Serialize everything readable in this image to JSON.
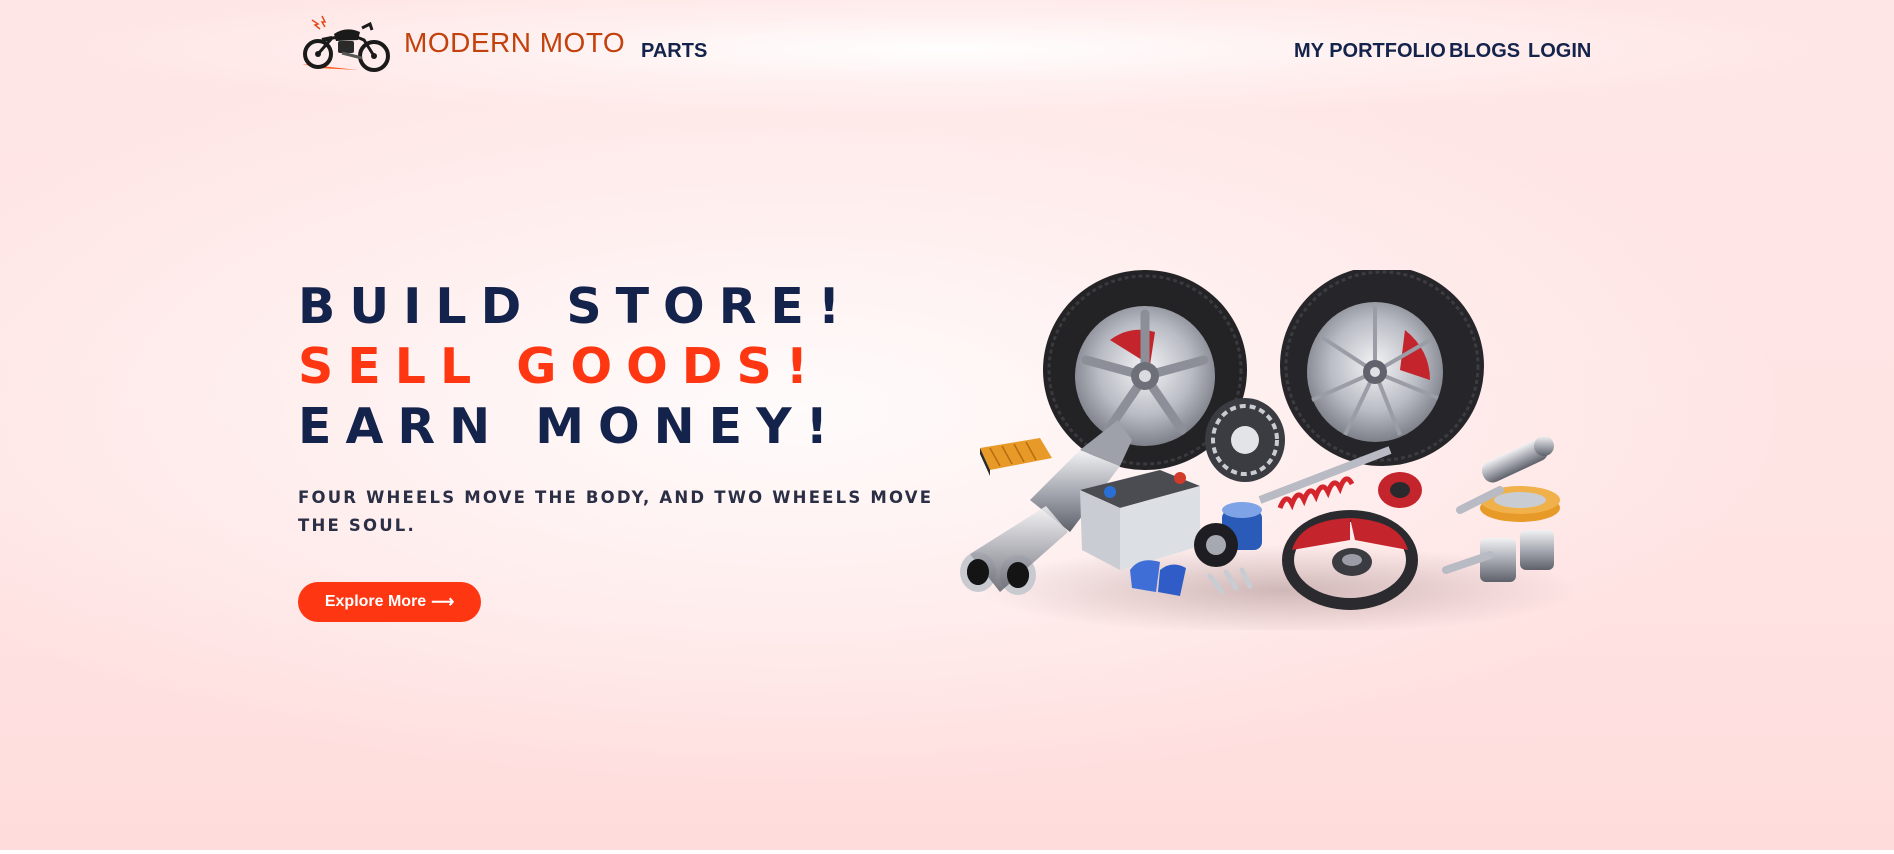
{
  "brand": {
    "name": "MODERN MOTO",
    "logo_icon": "motorcycle-icon",
    "color": "#c2410c"
  },
  "nav": {
    "parts": "PARTS",
    "portfolio": "MY PORTFOLIO",
    "blogs": "BLOGS",
    "login": "LOGIN"
  },
  "hero": {
    "line1": "BUILD STORE!",
    "line2": "SELL GOODS!",
    "line3": "EARN MONEY!",
    "tagline": "FOUR WHEELS MOVE THE BODY, AND TWO WHEELS MOVE THE SOUL.",
    "cta_label": "Explore More",
    "cta_arrow": "⟶",
    "illustration": "car-parts-collection"
  },
  "colors": {
    "navy": "#14234b",
    "accent": "#ff3612",
    "background": "#ffe4e4"
  }
}
